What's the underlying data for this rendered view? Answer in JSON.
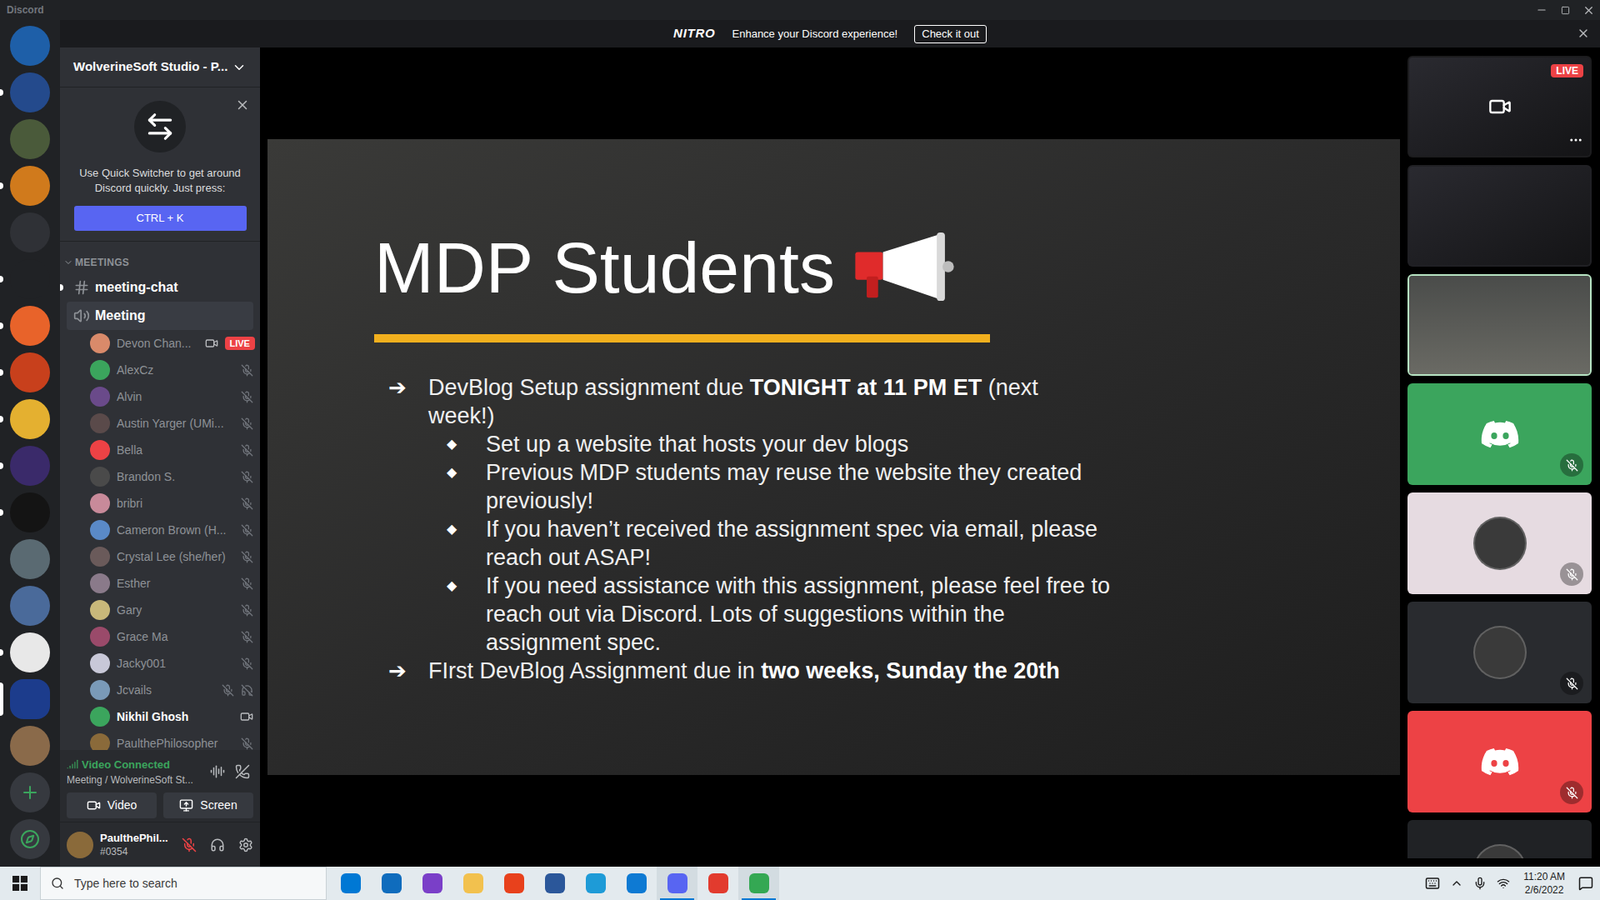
{
  "window": {
    "title": "Discord"
  },
  "nitro_banner": {
    "brand": "NITRO",
    "message": "Enhance your Discord experience!",
    "button": "Check it out"
  },
  "servers": [
    {
      "kind": "server",
      "color": "#1e5fa8",
      "unread": false,
      "selected": false
    },
    {
      "kind": "server",
      "color": "#244a8c",
      "unread": true,
      "selected": false
    },
    {
      "kind": "server",
      "color": "#4a5a3a",
      "unread": false,
      "selected": false
    },
    {
      "kind": "server",
      "color": "#d07a1c",
      "unread": true,
      "selected": false
    },
    {
      "kind": "server",
      "color": "#2f3136",
      "unread": false,
      "selected": false
    },
    {
      "kind": "server",
      "color": "#202225",
      "unread": true,
      "selected": false
    },
    {
      "kind": "server",
      "color": "#e8632a",
      "unread": true,
      "selected": false
    },
    {
      "kind": "server",
      "color": "#c8401c",
      "unread": true,
      "selected": false
    },
    {
      "kind": "server",
      "color": "#e4b030",
      "unread": true,
      "selected": false
    },
    {
      "kind": "server",
      "color": "#3a2a6a",
      "unread": true,
      "selected": false
    },
    {
      "kind": "server",
      "color": "#141414",
      "unread": true,
      "selected": false
    },
    {
      "kind": "server",
      "color": "#5a6a72",
      "unread": false,
      "selected": false
    },
    {
      "kind": "server",
      "color": "#4a6a9a",
      "unread": false,
      "selected": false
    },
    {
      "kind": "server",
      "color": "#e8e8e8",
      "unread": true,
      "selected": false
    },
    {
      "kind": "server",
      "color": "#1c3c8c",
      "unread": false,
      "selected": true
    },
    {
      "kind": "server",
      "color": "#8a6a4a",
      "unread": false,
      "selected": false
    },
    {
      "kind": "add",
      "color": "#3ba55d",
      "unread": false,
      "selected": false
    },
    {
      "kind": "explore",
      "color": "#3ba55d",
      "unread": false,
      "selected": false
    }
  ],
  "sidebar": {
    "server_name": "WolverineSoft Studio - P...",
    "quick_switcher": {
      "text": "Use Quick Switcher to get around Discord quickly. Just press:",
      "button": "CTRL + K"
    },
    "category": {
      "label": "MEETINGS",
      "expanded": true
    },
    "channels": [
      {
        "name": "meeting-chat",
        "kind": "text",
        "unread": true,
        "selected": false
      },
      {
        "name": "Meeting",
        "kind": "voice",
        "unread": false,
        "selected": true
      }
    ],
    "voice_users": [
      {
        "name": "Devon Chan...",
        "color": "#d98a6a",
        "muted": false,
        "deafened": false,
        "video": true,
        "badge": "LIVE",
        "highlighted": false
      },
      {
        "name": "AlexCz",
        "color": "#3ba55d",
        "muted": true,
        "deafened": false,
        "video": false,
        "badge": null,
        "highlighted": false
      },
      {
        "name": "Alvin",
        "color": "#6a4a8a",
        "muted": true,
        "deafened": false,
        "video": false,
        "badge": null,
        "highlighted": false
      },
      {
        "name": "Austin Yarger (UMi...",
        "color": "#5a4a4a",
        "muted": true,
        "deafened": false,
        "video": false,
        "badge": null,
        "highlighted": false
      },
      {
        "name": "Bella",
        "color": "#ed4245",
        "muted": true,
        "deafened": false,
        "video": false,
        "badge": null,
        "highlighted": false
      },
      {
        "name": "Brandon S.",
        "color": "#4a4a4a",
        "muted": true,
        "deafened": false,
        "video": false,
        "badge": null,
        "highlighted": false
      },
      {
        "name": "bribri",
        "color": "#c88a9a",
        "muted": true,
        "deafened": false,
        "video": false,
        "badge": null,
        "highlighted": false
      },
      {
        "name": "Cameron Brown (H...",
        "color": "#5a8ac8",
        "muted": true,
        "deafened": false,
        "video": false,
        "badge": null,
        "highlighted": false
      },
      {
        "name": "Crystal Lee (she/her)",
        "color": "#6a5a5a",
        "muted": true,
        "deafened": false,
        "video": false,
        "badge": null,
        "highlighted": false
      },
      {
        "name": "Esther",
        "color": "#8a7a8a",
        "muted": true,
        "deafened": false,
        "video": false,
        "badge": null,
        "highlighted": false
      },
      {
        "name": "Gary",
        "color": "#c8b87a",
        "muted": true,
        "deafened": false,
        "video": false,
        "badge": null,
        "highlighted": false
      },
      {
        "name": "Grace Ma",
        "color": "#9a4a6a",
        "muted": true,
        "deafened": false,
        "video": false,
        "badge": null,
        "highlighted": false
      },
      {
        "name": "Jacky001",
        "color": "#c8c8d8",
        "muted": true,
        "deafened": false,
        "video": false,
        "badge": null,
        "highlighted": false
      },
      {
        "name": "Jcvails",
        "color": "#7a9ab8",
        "muted": true,
        "deafened": true,
        "video": false,
        "badge": null,
        "highlighted": false
      },
      {
        "name": "Nikhil Ghosh",
        "color": "#3ba55d",
        "muted": false,
        "deafened": false,
        "video": true,
        "badge": null,
        "highlighted": true
      },
      {
        "name": "PaulthePhilosopher",
        "color": "#8a6a3a",
        "muted": true,
        "deafened": false,
        "video": false,
        "badge": null,
        "highlighted": false
      }
    ]
  },
  "voice_panel": {
    "status": "Video Connected",
    "location": "Meeting / WolverineSoft St...",
    "buttons": [
      "Video",
      "Screen"
    ]
  },
  "user_panel": {
    "name": "PaulthePhil...",
    "tag": "#0354",
    "muted": true,
    "color": "#8a6a3a"
  },
  "slide": {
    "title": "MDP Students",
    "bullets": [
      {
        "level": 1,
        "marker": "➔",
        "segments": [
          {
            "text": "DevBlog Setup assignment due ",
            "bold": false
          },
          {
            "text": "TONIGHT at 11 PM ET",
            "bold": true
          },
          {
            "text": " (next week!)",
            "bold": false
          }
        ]
      },
      {
        "level": 2,
        "marker": "◆",
        "segments": [
          {
            "text": "Set up a website that hosts your dev blogs",
            "bold": false
          }
        ]
      },
      {
        "level": 2,
        "marker": "◆",
        "segments": [
          {
            "text": "Previous MDP students may reuse the website they created previously!",
            "bold": false
          }
        ]
      },
      {
        "level": 2,
        "marker": "◆",
        "segments": [
          {
            "text": "If you haven’t received the assignment spec via email, please reach out ASAP!",
            "bold": false
          }
        ]
      },
      {
        "level": 2,
        "marker": "◆",
        "segments": [
          {
            "text": "If you need assistance with this assignment, please feel free to reach out via Discord. Lots of suggestions within the assignment spec.",
            "bold": false
          }
        ]
      },
      {
        "level": 1,
        "marker": "➔",
        "segments": [
          {
            "text": "FIrst DevBlog Assignment due in ",
            "bold": false
          },
          {
            "text": "two weeks, Sunday the 20th",
            "bold": true
          }
        ]
      }
    ]
  },
  "streams": [
    {
      "kind": "screen",
      "color": "#1c1c1e",
      "badge": "LIVE",
      "selected": false,
      "muted": false,
      "hovered": true
    },
    {
      "kind": "screen",
      "color": "#202024",
      "badge": null,
      "selected": false,
      "muted": false,
      "hovered": false
    },
    {
      "kind": "camera",
      "color": "#5a5e5a",
      "badge": null,
      "selected": true,
      "muted": false,
      "hovered": false
    },
    {
      "kind": "avatar",
      "color": "#3ba55d",
      "badge": null,
      "selected": false,
      "muted": true,
      "hovered": false
    },
    {
      "kind": "photo",
      "color": "#e6dbe1",
      "badge": null,
      "selected": false,
      "muted": true,
      "hovered": false
    },
    {
      "kind": "photo",
      "color": "#292b2f",
      "badge": null,
      "selected": false,
      "muted": true,
      "hovered": false
    },
    {
      "kind": "avatar",
      "color": "#ed4245",
      "badge": null,
      "selected": false,
      "muted": true,
      "hovered": false
    },
    {
      "kind": "photo",
      "color": "#202225",
      "badge": null,
      "selected": false,
      "muted": false,
      "hovered": false
    }
  ],
  "taskbar": {
    "search_placeholder": "Type here to search",
    "apps": [
      {
        "color": "#0078d4",
        "active": false
      },
      {
        "color": "#0f6cbd",
        "active": false
      },
      {
        "color": "#7a3fc8",
        "active": false
      },
      {
        "color": "#f2c14e",
        "active": false
      },
      {
        "color": "#e8411c",
        "active": false
      },
      {
        "color": "#2b579a",
        "active": false
      },
      {
        "color": "#1e9bd7",
        "active": false
      },
      {
        "color": "#0e7ad3",
        "active": false
      },
      {
        "color": "#5865f2",
        "active": true
      },
      {
        "color": "#e23b2e",
        "active": false
      },
      {
        "color": "#34a853",
        "active": true
      }
    ],
    "time": "11:20 AM",
    "date": "2/6/2022"
  }
}
